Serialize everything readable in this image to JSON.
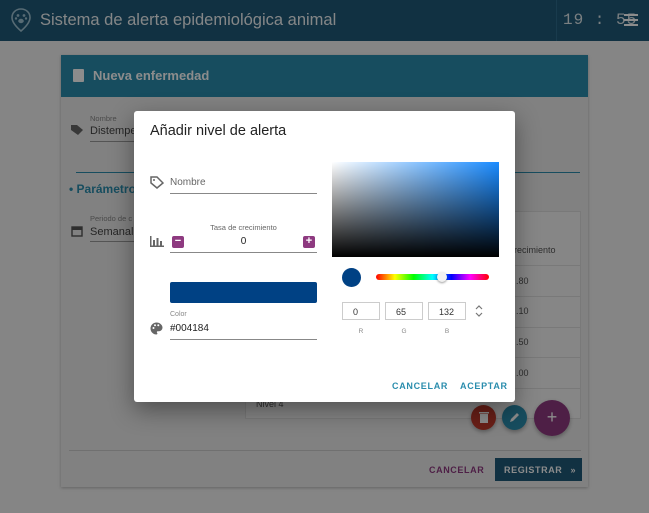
{
  "app": {
    "title": "Sistema de alerta epidemiológica animal",
    "clock": "19 : 55"
  },
  "card": {
    "title": "Nueva enfermedad"
  },
  "bg": {
    "nombre_label": "Nombre",
    "nombre_value": "Distemper",
    "section_title": "• Parámetros",
    "periodo_label": "Periodo de c",
    "periodo_value": "Semanal",
    "table_header": "recimiento",
    "table_values": [
      ".80",
      ".10",
      ".50",
      ".00"
    ],
    "last_row": "Nivel 4",
    "cancel_label": "CANCELAR",
    "register_label": "REGISTRAR"
  },
  "dialog": {
    "title": "Añadir nivel de alerta",
    "nombre_placeholder": "Nombre",
    "tasa_label": "Tasa de crecimiento",
    "tasa_value": "0",
    "minus_symbol": "−",
    "plus_symbol": "+",
    "color_label": "Color",
    "color_value": "#004184",
    "rgb": {
      "r": "0",
      "g": "65",
      "b": "132"
    },
    "rgb_labels": {
      "r": "R",
      "g": "G",
      "b": "B"
    },
    "cancel_label": "CANCELAR",
    "accept_label": "ACEPTAR"
  },
  "colors": {
    "appbar": "#205a78",
    "accent": "#2a8dad",
    "selected": "#004184",
    "stepper": "#8e3a80",
    "fab_delete": "#c0392b",
    "fab_edit": "#2a8dad",
    "fab_add": "#8e3a80"
  },
  "icons": [
    "paw-logo-icon",
    "menu-icon",
    "clipboard-icon",
    "tag-icon",
    "calendar-icon",
    "bar-chart-icon",
    "palette-icon",
    "delete-icon",
    "edit-icon",
    "plus-icon",
    "double-chevron-icon",
    "unfold-icon"
  ]
}
